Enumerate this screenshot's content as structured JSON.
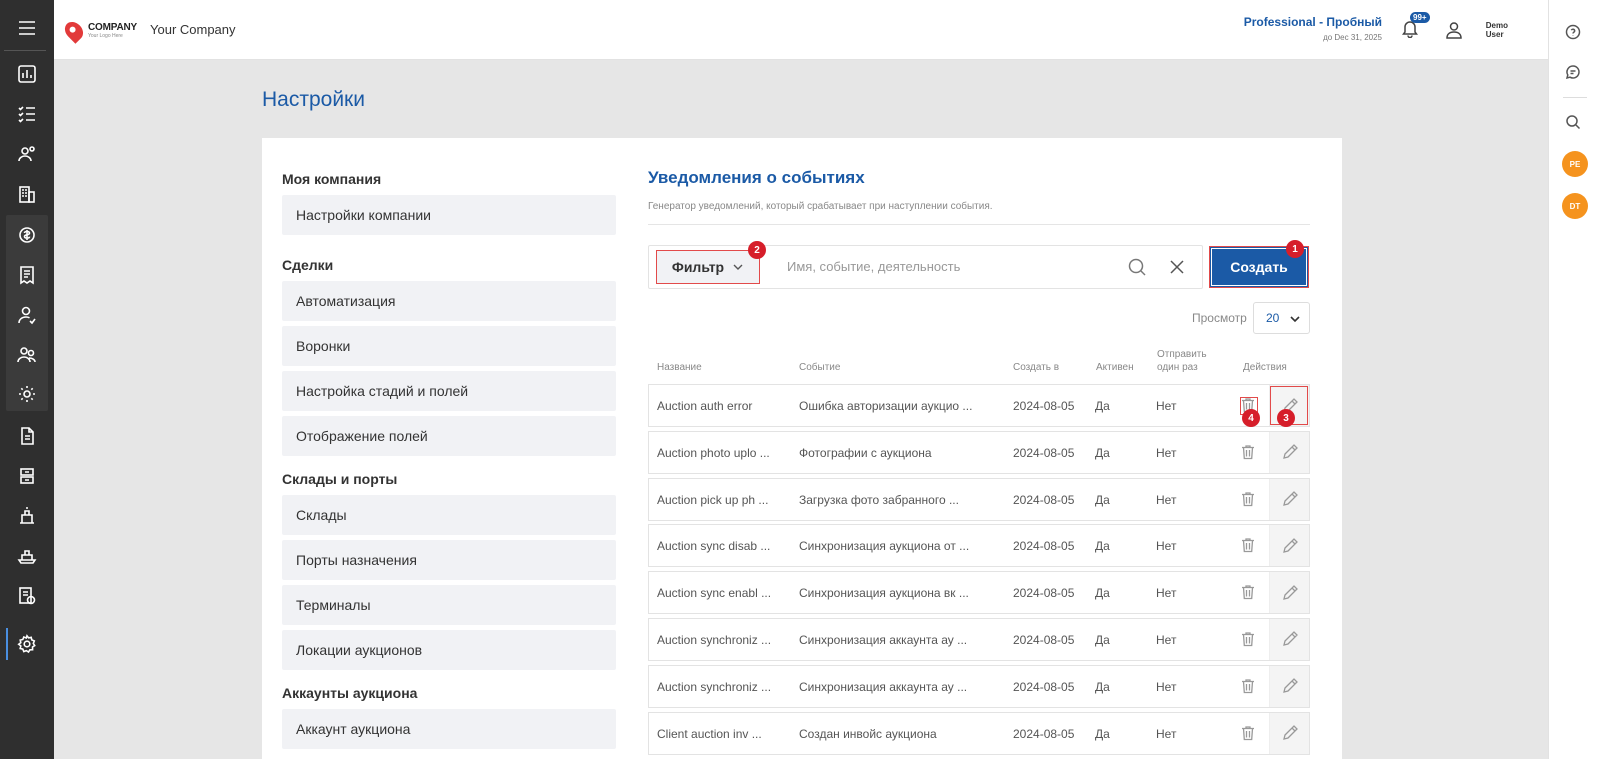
{
  "header": {
    "company_name": "Your Company",
    "logo_text": "COMPANY",
    "logo_tagline": "Your Logo Here",
    "plan_name": "Professional - Пробный",
    "plan_expiry": "до Dec 31, 2025",
    "notifications_badge": "99+",
    "user_name_line1": "Demo",
    "user_name_line2": "User"
  },
  "page": {
    "title": "Настройки"
  },
  "settings_nav": {
    "sections": [
      {
        "title": "Моя компания",
        "items": [
          "Настройки компании"
        ]
      },
      {
        "title": "Сделки",
        "items": [
          "Автоматизация",
          "Воронки",
          "Настройка стадий и полей",
          "Отображение полей"
        ]
      },
      {
        "title": "Склады и порты",
        "items": [
          "Склады",
          "Порты назначения",
          "Терминалы",
          "Локации аукционов"
        ]
      },
      {
        "title": "Аккаунты аукциона",
        "items": [
          "Аккаунт аукциона"
        ]
      }
    ]
  },
  "content": {
    "title": "Уведомления о событиях",
    "subtitle": "Генератор уведомлений, который срабатывает при наступлении события.",
    "filter_label": "Фильтр",
    "search_placeholder": "Имя, событие, деятельность",
    "create_label": "Создать",
    "view_label": "Просмотр",
    "view_value": "20",
    "markers": {
      "create": "1",
      "filter": "2",
      "edit": "3",
      "delete": "4"
    }
  },
  "table": {
    "columns": {
      "name": "Название",
      "event": "Событие",
      "created": "Создать в",
      "active": "Активен",
      "send_once_1": "Отправить",
      "send_once_2": "один раз",
      "actions": "Действия"
    },
    "rows": [
      {
        "name": "Auction auth error",
        "event": "Ошибка авторизации аукцио ...",
        "created": "2024-08-05",
        "active": "Да",
        "send_once": "Нет"
      },
      {
        "name": "Auction photo uplo ...",
        "event": "Фотографии с аукциона",
        "created": "2024-08-05",
        "active": "Да",
        "send_once": "Нет"
      },
      {
        "name": "Auction pick up ph ...",
        "event": "Загрузка фото забранного ...",
        "created": "2024-08-05",
        "active": "Да",
        "send_once": "Нет"
      },
      {
        "name": "Auction sync disab ...",
        "event": "Синхронизация аукциона от ...",
        "created": "2024-08-05",
        "active": "Да",
        "send_once": "Нет"
      },
      {
        "name": "Auction sync enabl ...",
        "event": "Синхронизация аукциона вк ...",
        "created": "2024-08-05",
        "active": "Да",
        "send_once": "Нет"
      },
      {
        "name": "Auction synchroniz ...",
        "event": "Синхронизация аккаунта ау ...",
        "created": "2024-08-05",
        "active": "Да",
        "send_once": "Нет"
      },
      {
        "name": "Auction synchroniz ...",
        "event": "Синхронизация аккаунта ау ...",
        "created": "2024-08-05",
        "active": "Да",
        "send_once": "Нет"
      },
      {
        "name": "Client auction inv ...",
        "event": "Создан инвойс аукциона",
        "created": "2024-08-05",
        "active": "Да",
        "send_once": "Нет"
      }
    ]
  },
  "rightbar": {
    "avatars": [
      "PE",
      "DT"
    ]
  },
  "colors": {
    "accent": "#1b5aa6",
    "sidebar": "#2f2f2f",
    "marker": "#d61e2a",
    "avatar": "#f5931e"
  }
}
